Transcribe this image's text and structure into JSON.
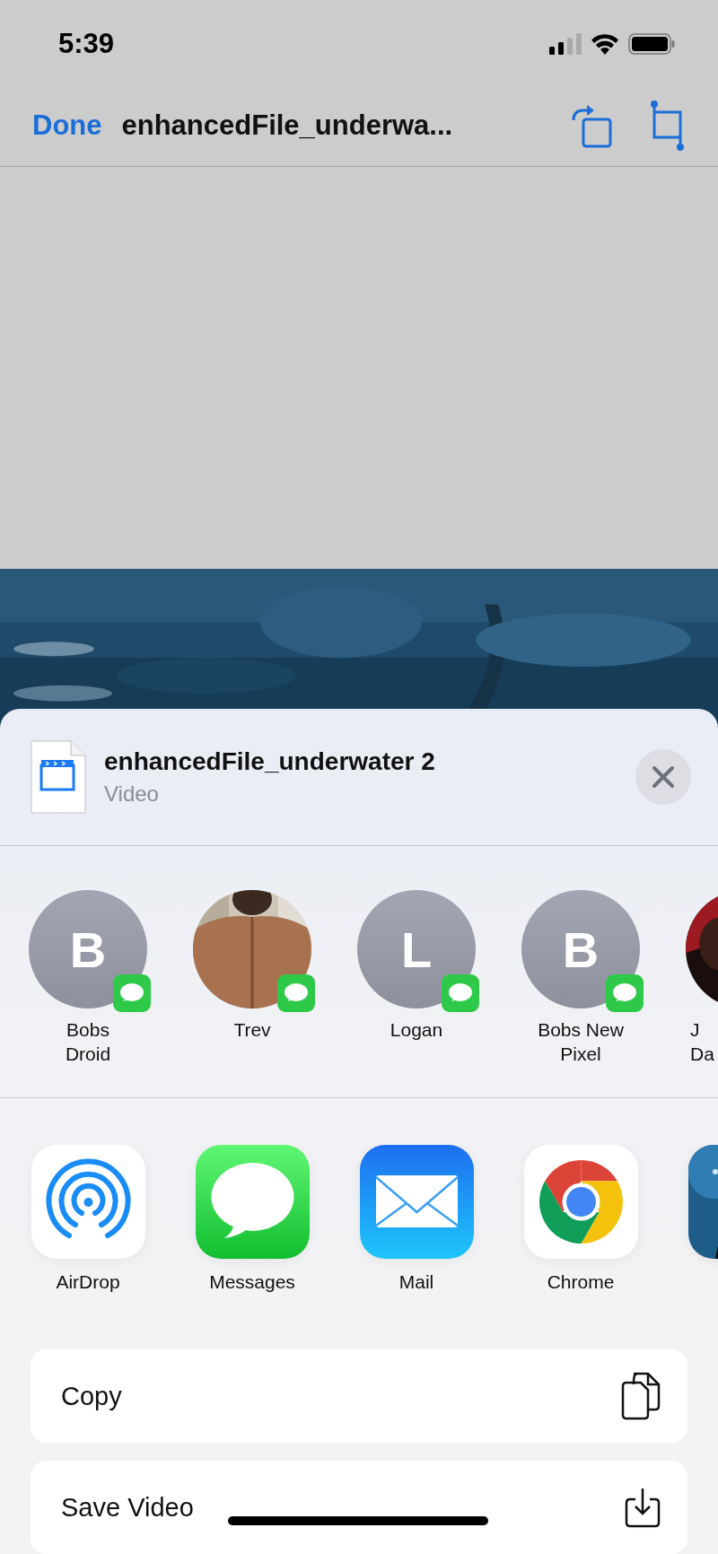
{
  "status_bar": {
    "time": "5:39"
  },
  "nav_bar": {
    "done": "Done",
    "title": "enhancedFile_underwa..."
  },
  "preview": {
    "kind": "picture"
  },
  "share_sheet": {
    "file": {
      "name": "enhancedFile_underwater 2",
      "type": "Video"
    },
    "contacts": [
      {
        "name": "Bobs\nDroid",
        "kind": "initial",
        "initial": "B",
        "badge": true
      },
      {
        "name": "Trev",
        "badge": true
      },
      {
        "name": "Logan",
        "kind": "initial",
        "initial": "L",
        "badge": true
      },
      {
        "name": "Bobs New\nPixel",
        "kind": "initial",
        "initial": "B",
        "badge": true
      },
      {
        "name": "J\nDa"
      }
    ],
    "apps": [
      {
        "label": "AirDrop",
        "kind": "airdrop"
      },
      {
        "label": "Messages",
        "kind": "messages"
      },
      {
        "label": "Mail",
        "kind": "mail"
      },
      {
        "label": "Chrome",
        "kind": "chrome"
      },
      {
        "kind": "picture"
      }
    ],
    "actions": [
      {
        "label": "Copy",
        "kind": "copy"
      },
      {
        "label": "Save Video",
        "kind": "save"
      }
    ]
  }
}
